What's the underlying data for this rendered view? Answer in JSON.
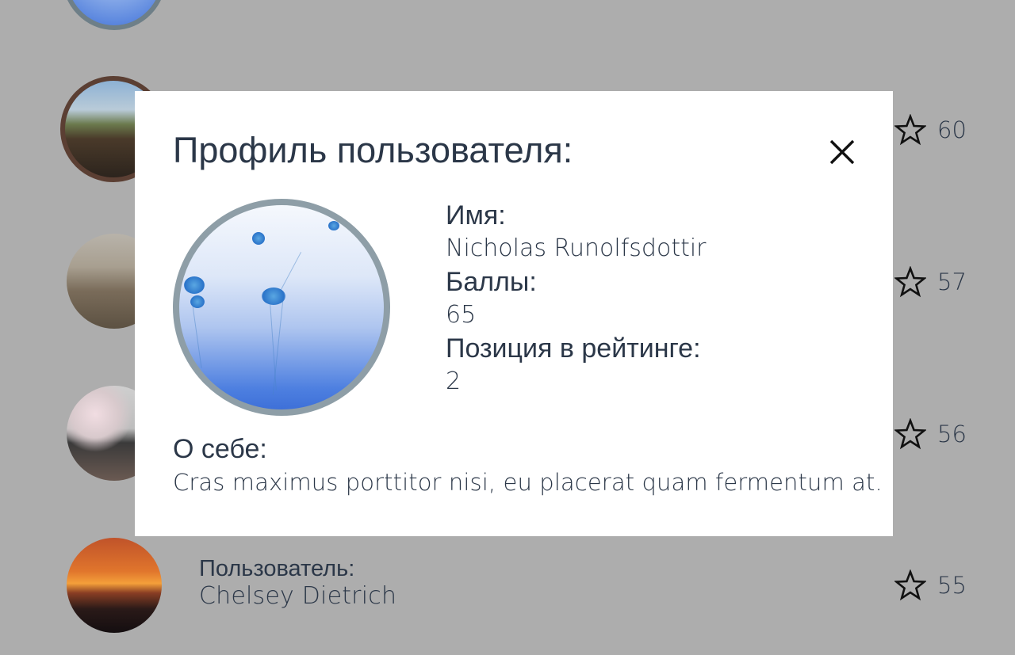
{
  "list": {
    "rows": [
      {
        "label": "",
        "name": "",
        "score": ""
      },
      {
        "label": "",
        "name": "",
        "score": "60"
      },
      {
        "label": "",
        "name": "",
        "score": "57"
      },
      {
        "label": "",
        "name": "",
        "score": "56"
      },
      {
        "label": "Пользователь:",
        "name": "Chelsey Dietrich",
        "score": "55"
      }
    ]
  },
  "modal": {
    "title": "Профиль пользователя:",
    "close_icon": "close-icon",
    "name_label": "Имя:",
    "name_value": "Nicholas Runolfsdottir",
    "points_label": "Баллы:",
    "points_value": "65",
    "rank_label": "Позиция в рейтинге:",
    "rank_value": "2",
    "about_label": "О себе:",
    "about_text": "Cras maximus porttitor nisi, eu placerat quam fermentum at."
  },
  "colors": {
    "backdrop": "#adadad",
    "text": "#2b3748",
    "modal_bg": "#ffffff",
    "avatar_border": "#8e9ea7"
  }
}
